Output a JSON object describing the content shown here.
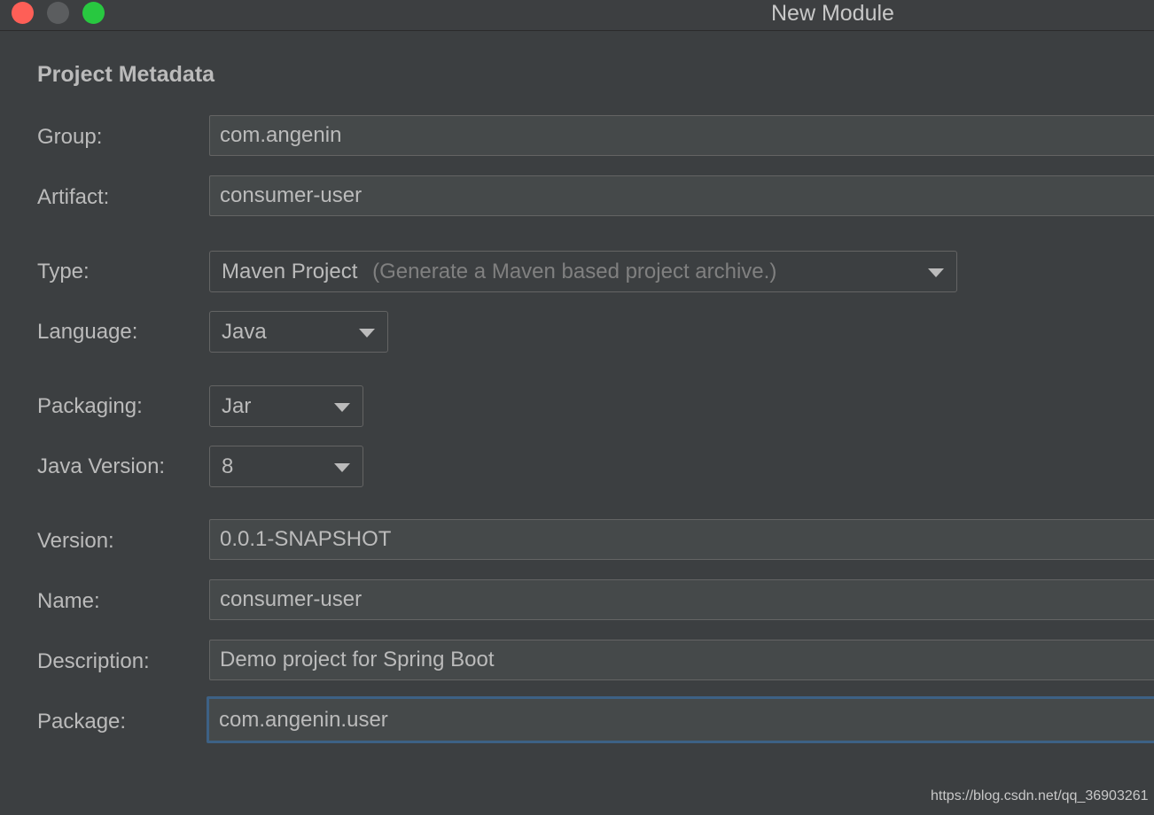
{
  "window": {
    "title": "New Module"
  },
  "section_title": "Project Metadata",
  "fields": {
    "group": {
      "label": "Group:",
      "value": "com.angenin"
    },
    "artifact": {
      "label": "Artifact:",
      "value": "consumer-user"
    },
    "type": {
      "label": "Type:",
      "value": "Maven Project",
      "hint": "(Generate a Maven based project archive.)"
    },
    "language": {
      "label": "Language:",
      "value": "Java"
    },
    "packaging": {
      "label": "Packaging:",
      "value": "Jar"
    },
    "java_version": {
      "label": "Java Version:",
      "value": "8"
    },
    "version": {
      "label": "Version:",
      "value": "0.0.1-SNAPSHOT"
    },
    "name": {
      "label": "Name:",
      "value": "consumer-user"
    },
    "description": {
      "label": "Description:",
      "value": "Demo project for Spring Boot"
    },
    "package": {
      "label": "Package:",
      "value": "com.angenin.user"
    }
  },
  "watermark": "https://blog.csdn.net/qq_36903261",
  "colors": {
    "background": "#3c3f41",
    "close": "#fe5f57",
    "maximize": "#28c840",
    "focus_border": "#3d6185"
  }
}
